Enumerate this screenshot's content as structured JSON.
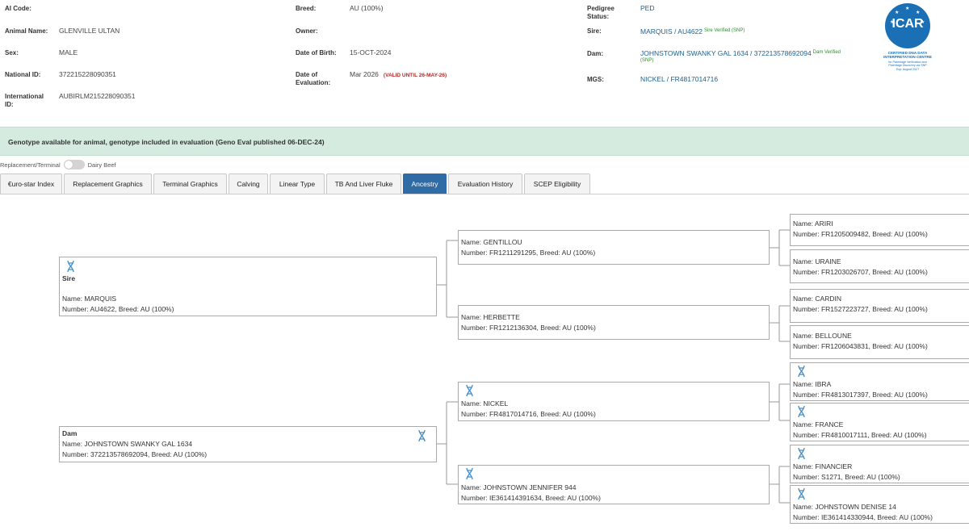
{
  "animal_info": {
    "ai_code_label": "AI Code:",
    "ai_code": "",
    "animal_name_label": "Animal Name:",
    "animal_name": "GLENVILLE ULTAN",
    "sex_label": "Sex:",
    "sex": "MALE",
    "national_id_label": "National ID:",
    "national_id": "372215228090351",
    "international_id_label": "International ID:",
    "international_id": "AUBIRLM215228090351",
    "breed_label": "Breed:",
    "breed": "AU (100%)",
    "owner_label": "Owner:",
    "owner": "",
    "dob_label": "Date of Birth:",
    "dob": "15-OCT-2024",
    "eval_date_label": "Date of Evaluation:",
    "eval_date": "Mar 2026",
    "eval_valid": "(VALID UNTIL 26-MAY-26)",
    "pedigree_status_label": "Pedigree Status:",
    "pedigree_status": "PED",
    "sire_label": "Sire:",
    "sire": "MARQUIS / AU4622",
    "sire_verified": "Sire Verified (SNP)",
    "dam_label": "Dam:",
    "dam": "JOHNSTOWN SWANKY GAL 1634 / 372213578692094",
    "dam_verified": "Dam Verified",
    "dam_verified_snp": "(SNP)",
    "mgs_label": "MGS:",
    "mgs": "NICKEL / FR4817014716"
  },
  "icar_badge": {
    "logo_text": "ICAR",
    "certified": "CERTIFIED DNA DATA",
    "interpretation": "INTERPRETATION CENTRE",
    "sub1": "for Parentage Verification and",
    "sub2": "Parentage Discovery via SNP",
    "sub3": "Exp: August 2027",
    "color": "#1a6fb5"
  },
  "banner": {
    "text": "Genotype available for animal, genotype included in evaluation (Geno Eval published 06-DEC-24)",
    "color": "#d5ebe0"
  },
  "toggle": {
    "left_label": "Replacement/Terminal",
    "right_label": "Dairy Beef",
    "state": "off"
  },
  "tabs": [
    {
      "label": "€uro-star Index",
      "active": false
    },
    {
      "label": "Replacement Graphics",
      "active": false
    },
    {
      "label": "Terminal Graphics",
      "active": false
    },
    {
      "label": "Calving",
      "active": false
    },
    {
      "label": "Linear Type",
      "active": false
    },
    {
      "label": "TB And Liver Fluke",
      "active": false
    },
    {
      "label": "Ancestry",
      "active": true
    },
    {
      "label": "Evaluation History",
      "active": false
    },
    {
      "label": "SCEP Eligibility",
      "active": false
    }
  ],
  "accent_color": "#2f6ca6",
  "pedigree": {
    "sire": {
      "role": "Sire",
      "name": "Name: MARQUIS",
      "number": "Number: AU4622, Breed: AU (100%)",
      "genotyped": true
    },
    "dam": {
      "role": "Dam",
      "name": "Name: JOHNSTOWN SWANKY GAL 1634",
      "number": "Number: 372213578692094, Breed: AU (100%)",
      "genotyped": true
    },
    "ss": {
      "name": "Name: GENTILLOU",
      "number": "Number: FR1211291295, Breed: AU (100%)",
      "genotyped": false
    },
    "sd": {
      "name": "Name: HERBETTE",
      "number": "Number: FR1212136304, Breed: AU (100%)",
      "genotyped": false
    },
    "ds": {
      "name": "Name: NICKEL",
      "number": "Number: FR4817014716, Breed: AU (100%)",
      "genotyped": true
    },
    "dd": {
      "name": "Name: JOHNSTOWN JENNIFER 944",
      "number": "Number: IE361414391634, Breed: AU (100%)",
      "genotyped": true
    },
    "sss": {
      "name": "Name: ARIRI",
      "number": "Number: FR1205009482, Breed: AU (100%)",
      "genotyped": false
    },
    "ssd": {
      "name": "Name: URAINE",
      "number": "Number: FR1203026707, Breed: AU (100%)",
      "genotyped": false
    },
    "sds": {
      "name": "Name: CARDIN",
      "number": "Number: FR1527223727, Breed: AU (100%)",
      "genotyped": false
    },
    "sdd": {
      "name": "Name: BELLOUNE",
      "number": "Number: FR1206043831, Breed: AU (100%)",
      "genotyped": false
    },
    "dss": {
      "name": "Name: IBRA",
      "number": "Number: FR4813017397, Breed: AU (100%)",
      "genotyped": true
    },
    "dsd": {
      "name": "Name: FRANCE",
      "number": "Number: FR4810017111, Breed: AU (100%)",
      "genotyped": true
    },
    "dds": {
      "name": "Name: FINANCIER",
      "number": "Number: S1271, Breed: AU (100%)",
      "genotyped": true
    },
    "ddd": {
      "name": "Name: JOHNSTOWN DENISE 14",
      "number": "Number: IE361414330944, Breed: AU (100%)",
      "genotyped": true
    }
  }
}
